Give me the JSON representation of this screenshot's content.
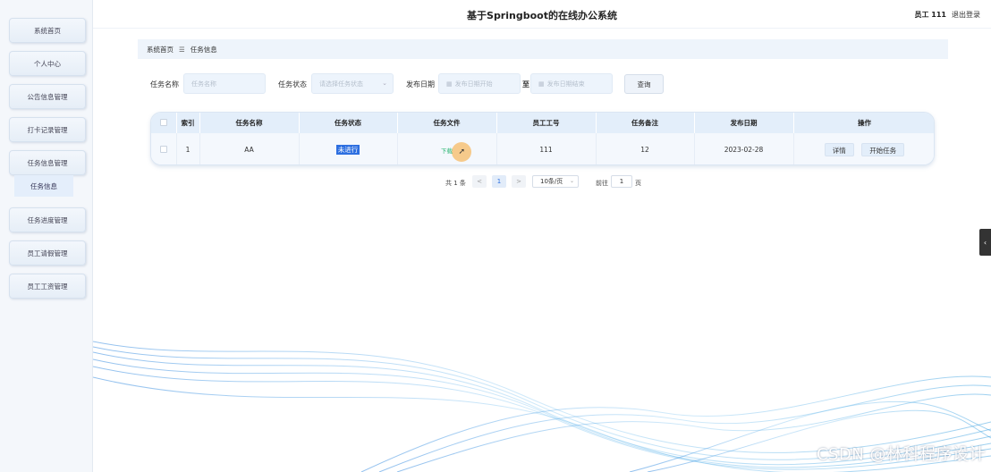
{
  "header": {
    "title": "基于Springboot的在线办公系统",
    "user_label": "员工 111",
    "logout_label": "退出登录"
  },
  "sidebar": {
    "items": [
      {
        "label": "系统首页"
      },
      {
        "label": "个人中心"
      },
      {
        "label": "公告信息管理"
      },
      {
        "label": "打卡记录管理"
      },
      {
        "label": "任务信息管理"
      },
      {
        "label": "任务进度管理"
      },
      {
        "label": "员工请假管理"
      },
      {
        "label": "员工工资管理"
      }
    ],
    "subitem_label": "任务信息"
  },
  "breadcrumb": {
    "home": "系统首页",
    "separator_icon": "menu-icon",
    "current": "任务信息"
  },
  "filters": {
    "task_name_label": "任务名称",
    "task_name_placeholder": "任务名称",
    "task_status_label": "任务状态",
    "task_status_placeholder": "请选择任务状态",
    "publish_date_label": "发布日期",
    "date_start_placeholder": "发布日期开始",
    "date_to": "至",
    "date_end_placeholder": "发布日期结束",
    "query_button": "查询"
  },
  "table": {
    "columns": [
      "索引",
      "任务名称",
      "任务状态",
      "任务文件",
      "员工工号",
      "任务备注",
      "发布日期",
      "操作"
    ],
    "rows": [
      {
        "index": "1",
        "task_name": "AA",
        "task_status": "未进行",
        "task_file": "下载",
        "employee_id": "111",
        "remark": "12",
        "publish_date": "2023-02-28",
        "detail_button": "详情",
        "start_button": "开始任务"
      }
    ]
  },
  "pagination": {
    "total": "共 1 条",
    "prev": "<",
    "current_page": "1",
    "next": ">",
    "page_size": "10条/页",
    "goto_label": "前往",
    "goto_value": "1",
    "page_suffix": "页"
  },
  "watermark": "CSDN @林科程序设计",
  "colors": {
    "accent": "#2d6fe0",
    "link_green": "#2bb673",
    "header_row": "#e3eefa"
  }
}
